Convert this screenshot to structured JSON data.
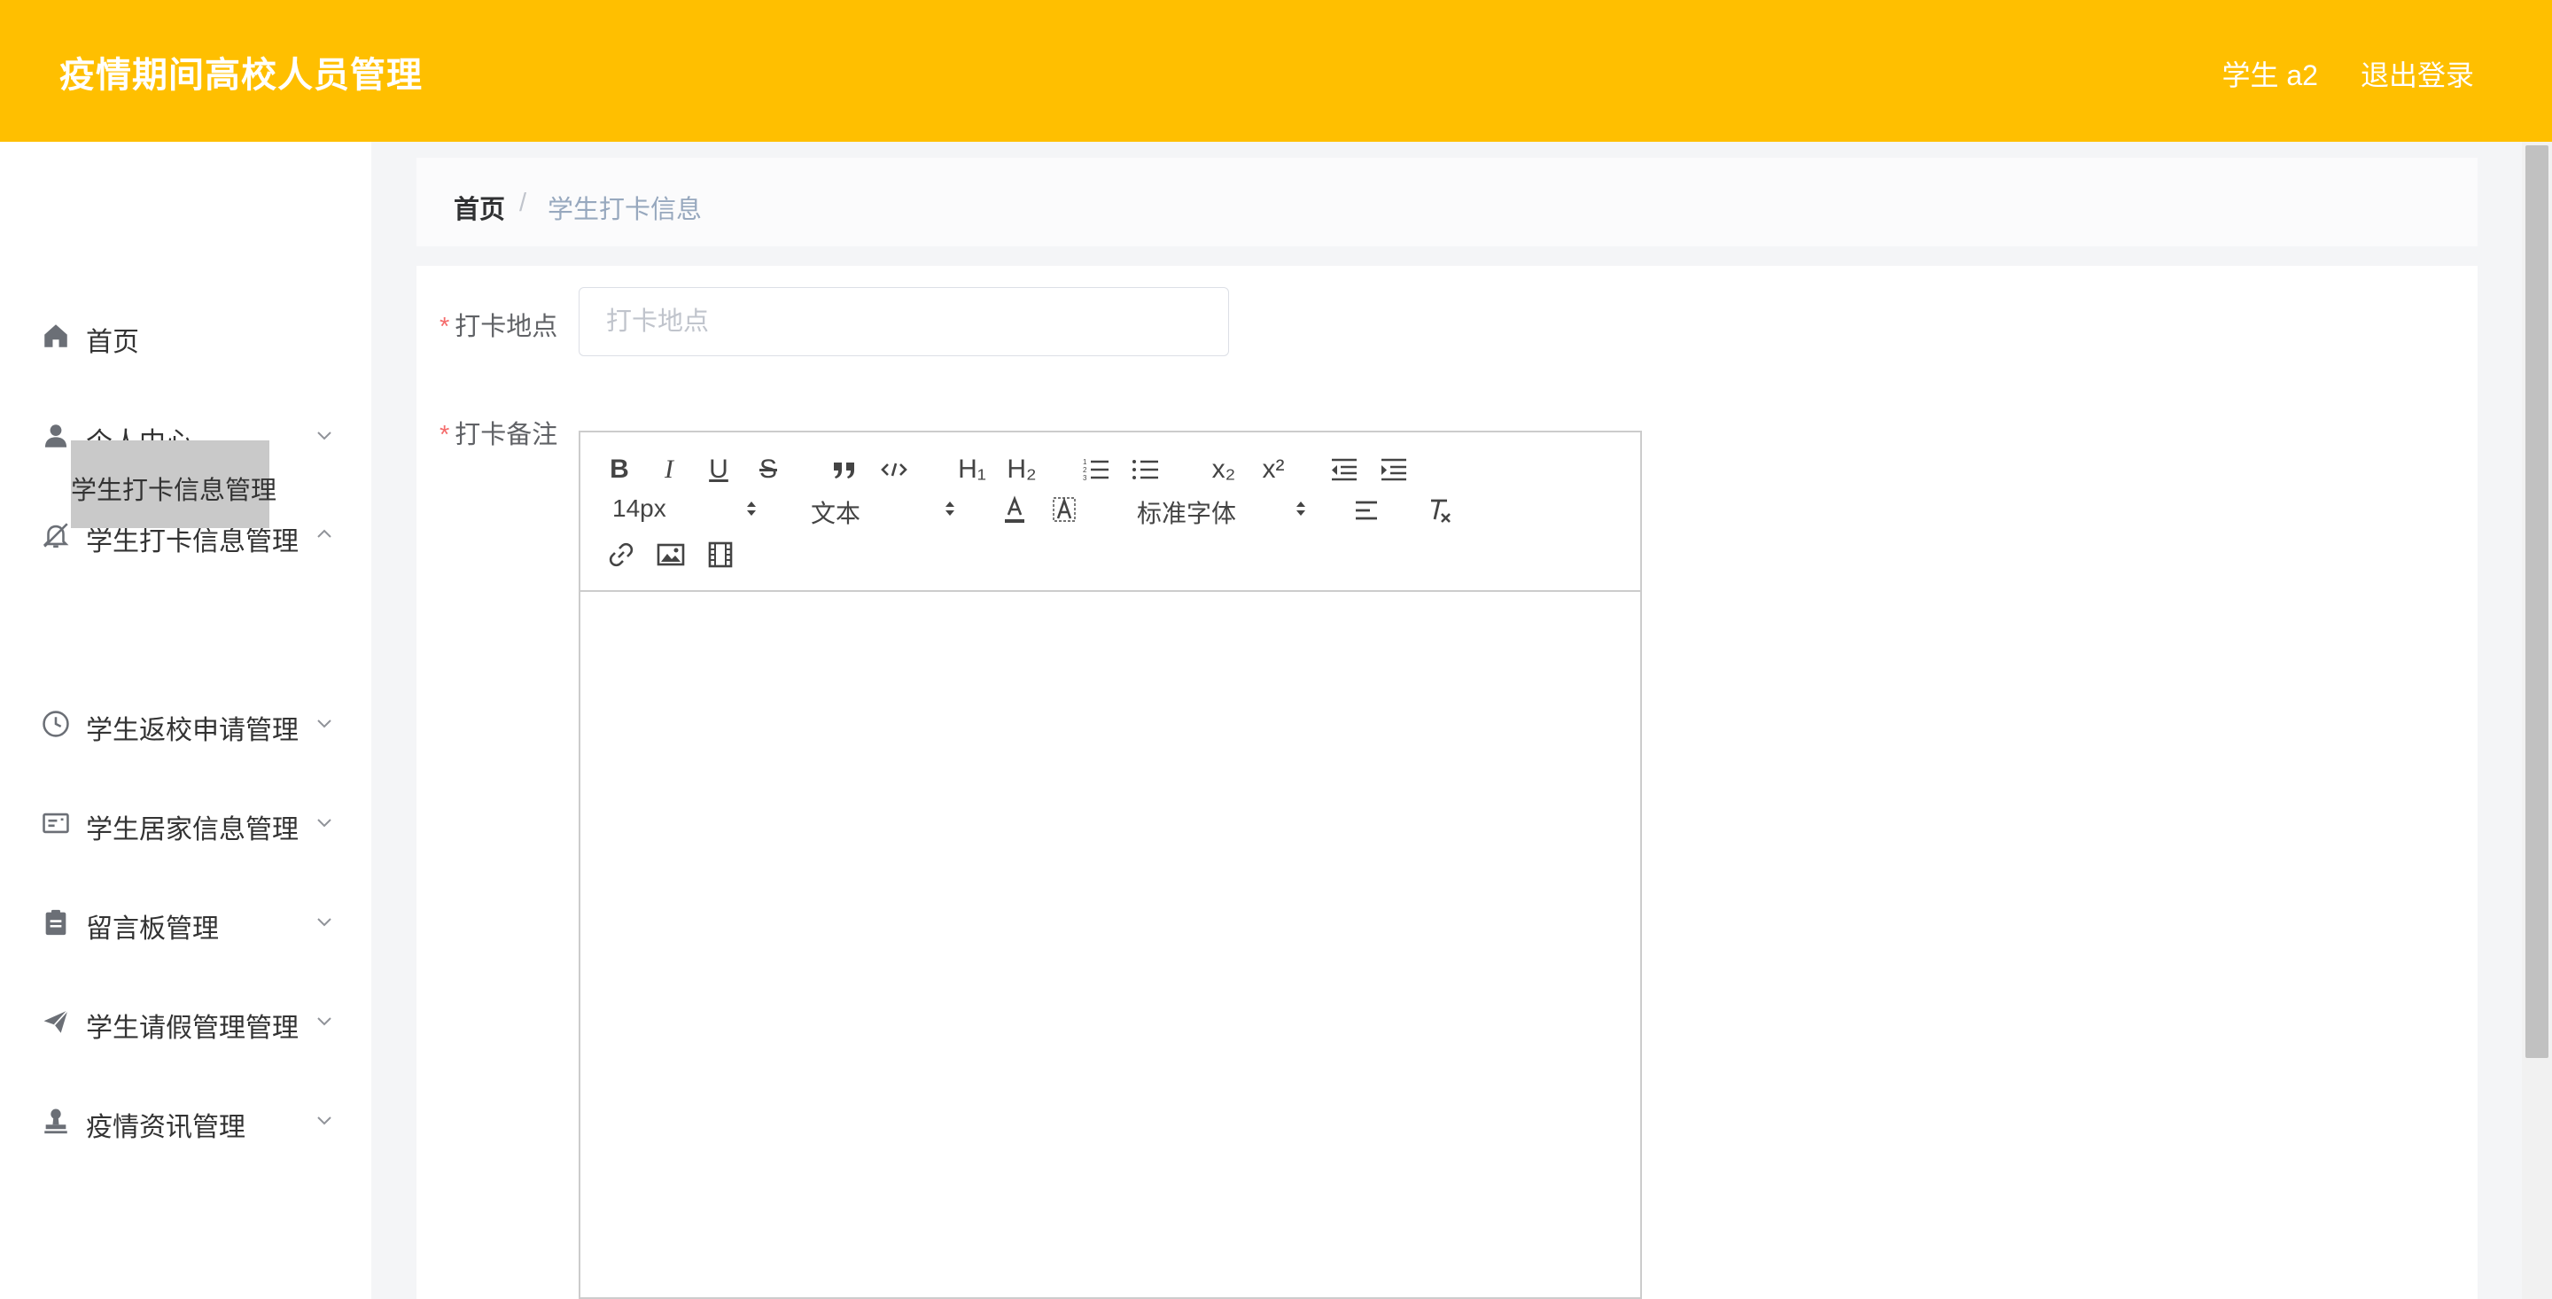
{
  "header": {
    "app_title": "疫情期间高校人员管理",
    "user": "学生 a2",
    "logout": "退出登录"
  },
  "sidebar": {
    "items": [
      {
        "label": "首页",
        "icon": "home-icon"
      },
      {
        "label": "个人中心",
        "icon": "user-icon"
      },
      {
        "label": "学生打卡信息管理",
        "icon": "bell-off-icon",
        "expanded": true
      },
      {
        "label": "学生返校申请管理",
        "icon": "clock-icon"
      },
      {
        "label": "学生居家信息管理",
        "icon": "id-card-icon"
      },
      {
        "label": "留言板管理",
        "icon": "clipboard-icon"
      },
      {
        "label": "学生请假管理管理",
        "icon": "paper-plane-icon"
      },
      {
        "label": "疫情资讯管理",
        "icon": "stamp-icon"
      }
    ],
    "submenu_active": "学生打卡信息管理"
  },
  "breadcrumb": {
    "home": "首页",
    "separator": "/",
    "current": "学生打卡信息"
  },
  "form": {
    "required_mark": "*",
    "location_label": "打卡地点",
    "location_placeholder": "打卡地点",
    "location_value": "",
    "remark_label": "打卡备注"
  },
  "editor": {
    "font_size": "14px",
    "header_select": "文本",
    "font_family": "标准字体",
    "bold": "B",
    "italic": "I",
    "underline": "U",
    "strike": "S",
    "h1": "H₁",
    "h2": "H₂",
    "sub": "x₂",
    "sup": "x²"
  },
  "colors": {
    "header_bg": "#ffbf00",
    "submenu_active_bg": "#c9c9c9",
    "required": "#f56c6c"
  }
}
